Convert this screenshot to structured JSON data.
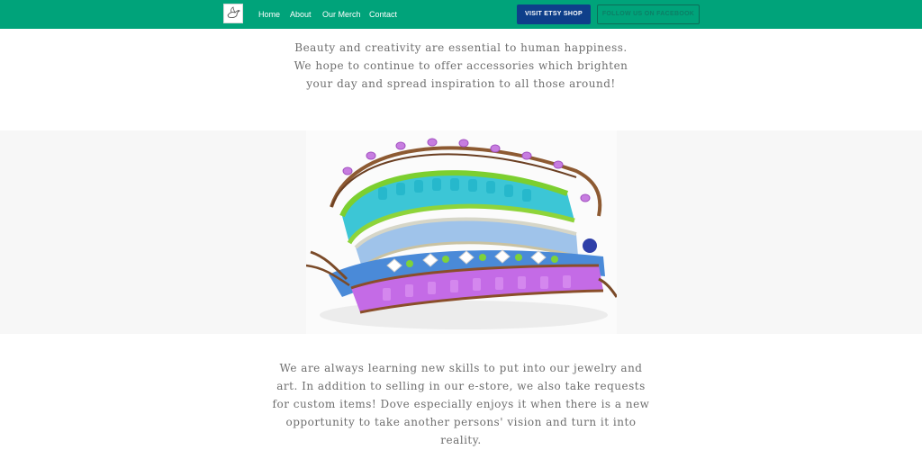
{
  "header": {
    "nav": [
      {
        "label": "Home"
      },
      {
        "label": "About"
      },
      {
        "label": "Our Merch"
      },
      {
        "label": "Contact"
      }
    ],
    "etsy_button": "VISIT ETSY SHOP",
    "facebook_button": "FOLLOW US ON FACEBOOK"
  },
  "content": {
    "intro": "Beauty and creativity are essential to human happiness. We hope to continue to offer accessories which brighten your day and spread inspiration to all those around!",
    "closing": "We are always learning new skills to put into our jewelry and art. In addition to selling in our e-store, we also take requests for custom items! Dove especially enjoys it when there is a new opportunity to take another persons' vision and turn it into reality."
  },
  "colors": {
    "brand_green": "#00a37a",
    "etsy_blue": "#0e3f8a",
    "text_gray": "#6e6e6e",
    "band_gray": "#f7f7f7"
  },
  "icons": {
    "logo": "dove-logo-icon"
  }
}
